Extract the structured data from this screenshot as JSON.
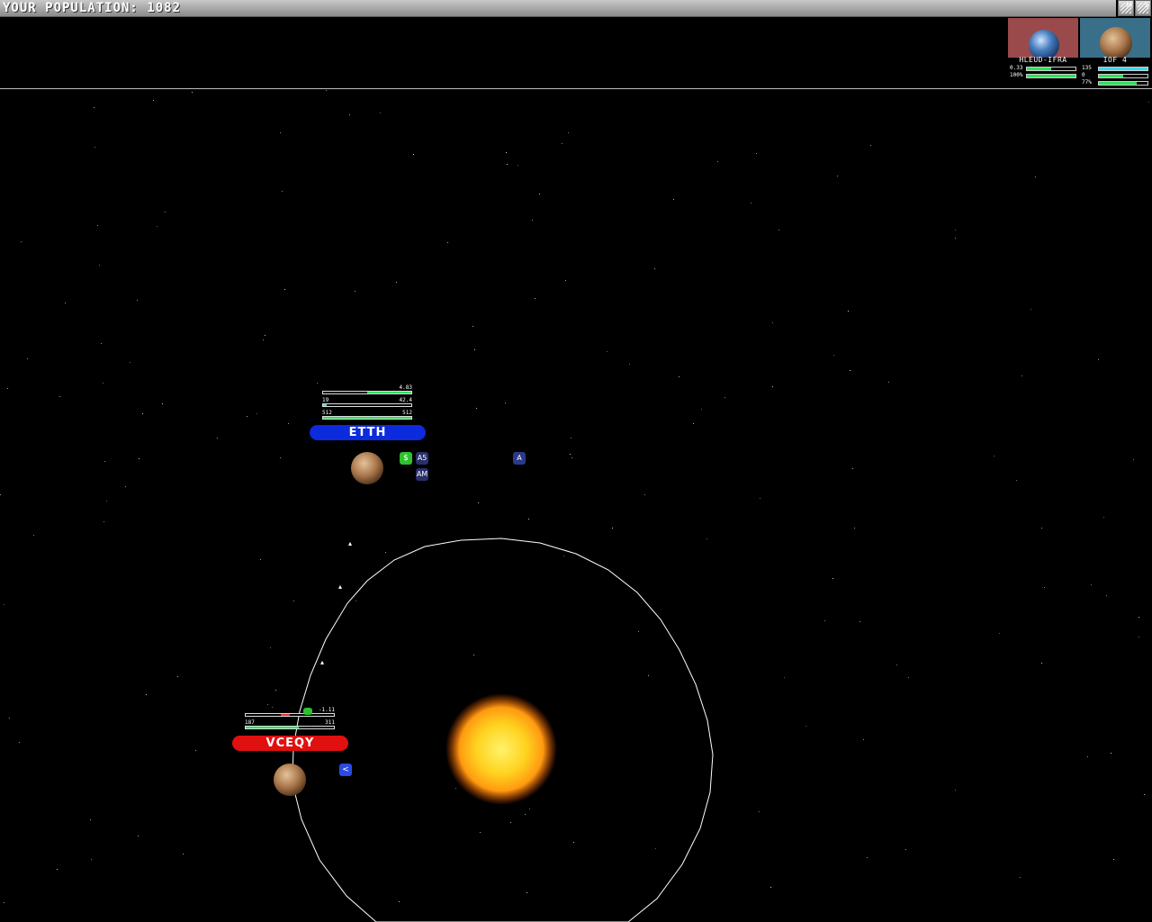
{
  "hud": {
    "population_label": "YOUR POPULATION: 1082",
    "buttons": [
      "M",
      "S"
    ]
  },
  "cards": [
    {
      "name": "HLEUD-IFRA",
      "bg": "#9a4a4a",
      "rows": [
        {
          "label": "0.33",
          "fill": 0.5,
          "color": "#2fe05a"
        },
        {
          "label": "100%",
          "fill": 1.0,
          "color": "#2fe05a"
        }
      ]
    },
    {
      "name": "IOF 4",
      "bg": "#3a6f8a",
      "rows": [
        {
          "label": "135",
          "fill": 1.0,
          "color": "#3fd8e8"
        },
        {
          "label": "0",
          "fill": 0.5,
          "color": "#2fe05a"
        },
        {
          "label": "77%",
          "fill": 0.77,
          "color": "#2fe05a"
        }
      ]
    }
  ],
  "planets": [
    {
      "name": "ETTH",
      "pill_color": "#0b2bdc",
      "rate": "4.83",
      "rate_fill": 0.5,
      "row2_left": "19",
      "row2_right": "42.4",
      "row2_fill": 0.04,
      "row2_color": "#3fd8e8",
      "row3_left": "512",
      "row3_right": "512",
      "row3_fill": 1.0,
      "icons": [
        {
          "name": "dollar-icon",
          "glyph": "$",
          "color": "#2fc02f"
        },
        {
          "name": "production-icon",
          "glyph": "A5",
          "color": "#2a2f6a"
        },
        {
          "name": "research-icon",
          "glyph": "AM",
          "color": "#2a2f6a"
        },
        {
          "name": "fleet-icon",
          "glyph": "A",
          "color": "#2a3a8a"
        }
      ]
    },
    {
      "name": "VCEQY",
      "pill_color": "#e01010",
      "rate": "-1.11",
      "rate_fill": 0.45,
      "row2_left": "187",
      "row2_right": "311",
      "row2_fill": 0.6,
      "row2_color": "#2fe05a",
      "icons": [
        {
          "name": "flag-icon",
          "glyph": "F",
          "color": "#2fc02f"
        },
        {
          "name": "fleet-icon",
          "glyph": "<",
          "color": "#2a4ae0"
        }
      ]
    }
  ],
  "colors": {
    "sun_core": "#ffd21f",
    "sun_glow": "#ff7a00",
    "orbit": "#ffffff",
    "planet": "#b07a4a"
  }
}
